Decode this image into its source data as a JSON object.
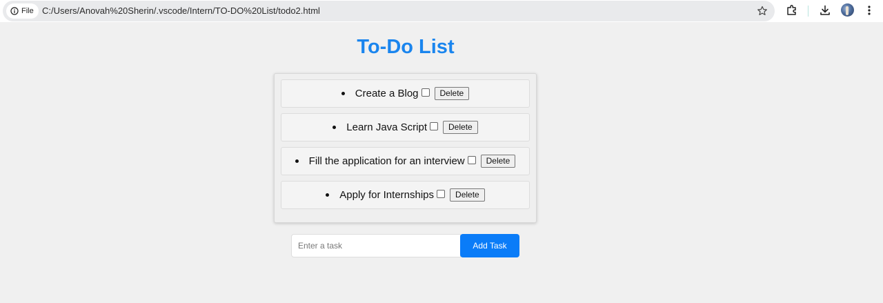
{
  "browser": {
    "site_chip_label": "File",
    "url": "C:/Users/Anovah%20Sherin/.vscode/Intern/TO-DO%20List/todo2.html",
    "icons": [
      "info-icon",
      "bookmark-star-icon",
      "extensions-icon",
      "downloads-icon",
      "avatar",
      "more-vert-icon"
    ]
  },
  "page": {
    "title": "To-Do List",
    "title_color": "#1a85ee"
  },
  "tasks": [
    {
      "text": "Create a Blog",
      "checked": false,
      "delete_label": "Delete"
    },
    {
      "text": "Learn Java Script",
      "checked": false,
      "delete_label": "Delete"
    },
    {
      "text": "Fill the application for an interview",
      "checked": false,
      "delete_label": "Delete"
    },
    {
      "text": "Apply for Internships",
      "checked": false,
      "delete_label": "Delete"
    }
  ],
  "form": {
    "input_placeholder": "Enter a task",
    "input_value": "",
    "add_label": "Add Task",
    "add_color": "#0a7cf8"
  }
}
